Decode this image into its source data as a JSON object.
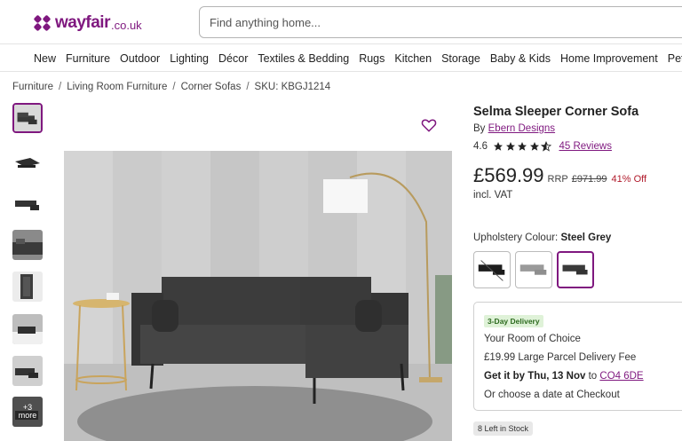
{
  "header": {
    "logo_text": "wayfair",
    "logo_tld": ".co.uk",
    "search_placeholder": "Find anything home..."
  },
  "nav": {
    "items": [
      "New",
      "Furniture",
      "Outdoor",
      "Lighting",
      "Décor",
      "Textiles & Bedding",
      "Rugs",
      "Kitchen",
      "Storage",
      "Baby & Kids",
      "Home Improvement",
      "Pet"
    ]
  },
  "breadcrumb": {
    "items": [
      "Furniture",
      "Living Room Furniture",
      "Corner Sofas"
    ],
    "separator": "/",
    "sku": "SKU: KBGJ1214"
  },
  "gallery": {
    "more_count": "+3",
    "more_label": "more"
  },
  "product": {
    "title": "Selma Sleeper Corner Sofa",
    "by_prefix": "By",
    "brand": "Ebern Designs",
    "rating": "4.6",
    "rating_value": 4.6,
    "reviews": "45 Reviews",
    "price": "£569.99",
    "rrp_label": "RRP",
    "rrp_value": "£971.99",
    "discount": "41% Off",
    "vat": "incl. VAT",
    "colour_label": "Upholstery Colour:",
    "colour_value": "Steel Grey"
  },
  "delivery": {
    "badge": "3-Day Delivery",
    "line1": "Your Room of Choice",
    "line2": "£19.99 Large Parcel Delivery Fee",
    "get_it_prefix": "Get it by Thu, 13 Nov",
    "get_it_to": "to",
    "postcode": "CO4 6DE",
    "line4": "Or choose a date at Checkout"
  },
  "stock": "8 Left in Stock",
  "colors": {
    "brand": "#7f187f",
    "discount": "#b0192a",
    "badge_green": "#2d6b1f"
  }
}
